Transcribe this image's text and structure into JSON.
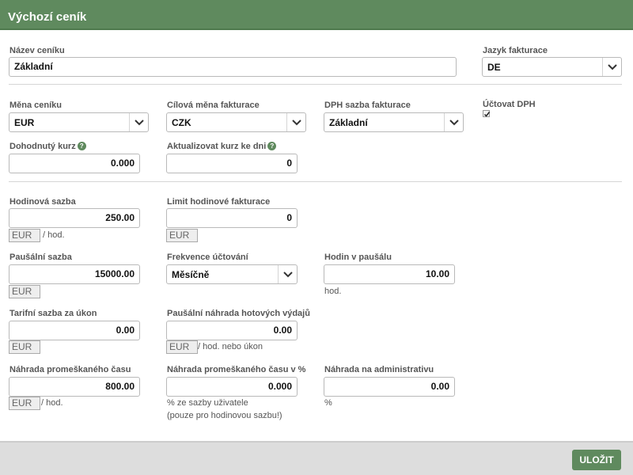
{
  "header": {
    "title": "Výchozí ceník"
  },
  "pricelist_name": {
    "label": "Název ceníku",
    "value": "Základní"
  },
  "invoice_language": {
    "label": "Jazyk fakturace",
    "value": "DE"
  },
  "currency": {
    "label": "Měna ceníku",
    "value": "EUR"
  },
  "target_currency": {
    "label": "Cílová měna fakturace",
    "value": "CZK"
  },
  "vat_rate": {
    "label": "DPH sazba fakturace",
    "value": "Základní"
  },
  "charge_vat": {
    "label": "Účtovat DPH",
    "checked": true
  },
  "agreed_rate": {
    "label": "Dohodnutý kurz",
    "value": "0.000"
  },
  "update_rate_days": {
    "label": "Aktualizovat kurz ke dni",
    "value": "0"
  },
  "hourly_rate": {
    "label": "Hodinová sazba",
    "value": "250.00",
    "currency": "EUR",
    "unit": "/ hod."
  },
  "hourly_invoice_limit": {
    "label": "Limit hodinové fakturace",
    "value": "0",
    "currency": "EUR"
  },
  "flat_rate": {
    "label": "Paušální sazba",
    "value": "15000.00",
    "currency": "EUR"
  },
  "billing_frequency": {
    "label": "Frekvence účtování",
    "value": "Měsíčně"
  },
  "hours_in_flat": {
    "label": "Hodin v paušálu",
    "value": "10.00",
    "unit": "hod."
  },
  "tariff_rate": {
    "label": "Tarifní sazba za úkon",
    "value": "0.00",
    "currency": "EUR"
  },
  "flat_expenses": {
    "label": "Paušální náhrada hotových výdajů",
    "value": "0.00",
    "currency": "EUR",
    "unit": "/ hod. nebo úkon"
  },
  "lost_time": {
    "label": "Náhrada promeškaného času",
    "value": "800.00",
    "currency": "EUR",
    "unit": "/ hod."
  },
  "lost_time_pct": {
    "label": "Náhrada promeškaného času v %",
    "value": "0.000",
    "note_line1": "% ze sazby uživatele",
    "note_line2": "(pouze pro hodinovou sazbu!)"
  },
  "admin_fee": {
    "label": "Náhrada na administrativu",
    "value": "0.00",
    "unit": "%"
  },
  "footer": {
    "save_label": "ULOŽIT"
  },
  "icons": {
    "help": "help-circle-icon",
    "dropdown": "chevron-down-icon",
    "check": "checkmark-icon"
  },
  "colors": {
    "accent": "#5f8a5e",
    "footer": "#dddddd"
  }
}
